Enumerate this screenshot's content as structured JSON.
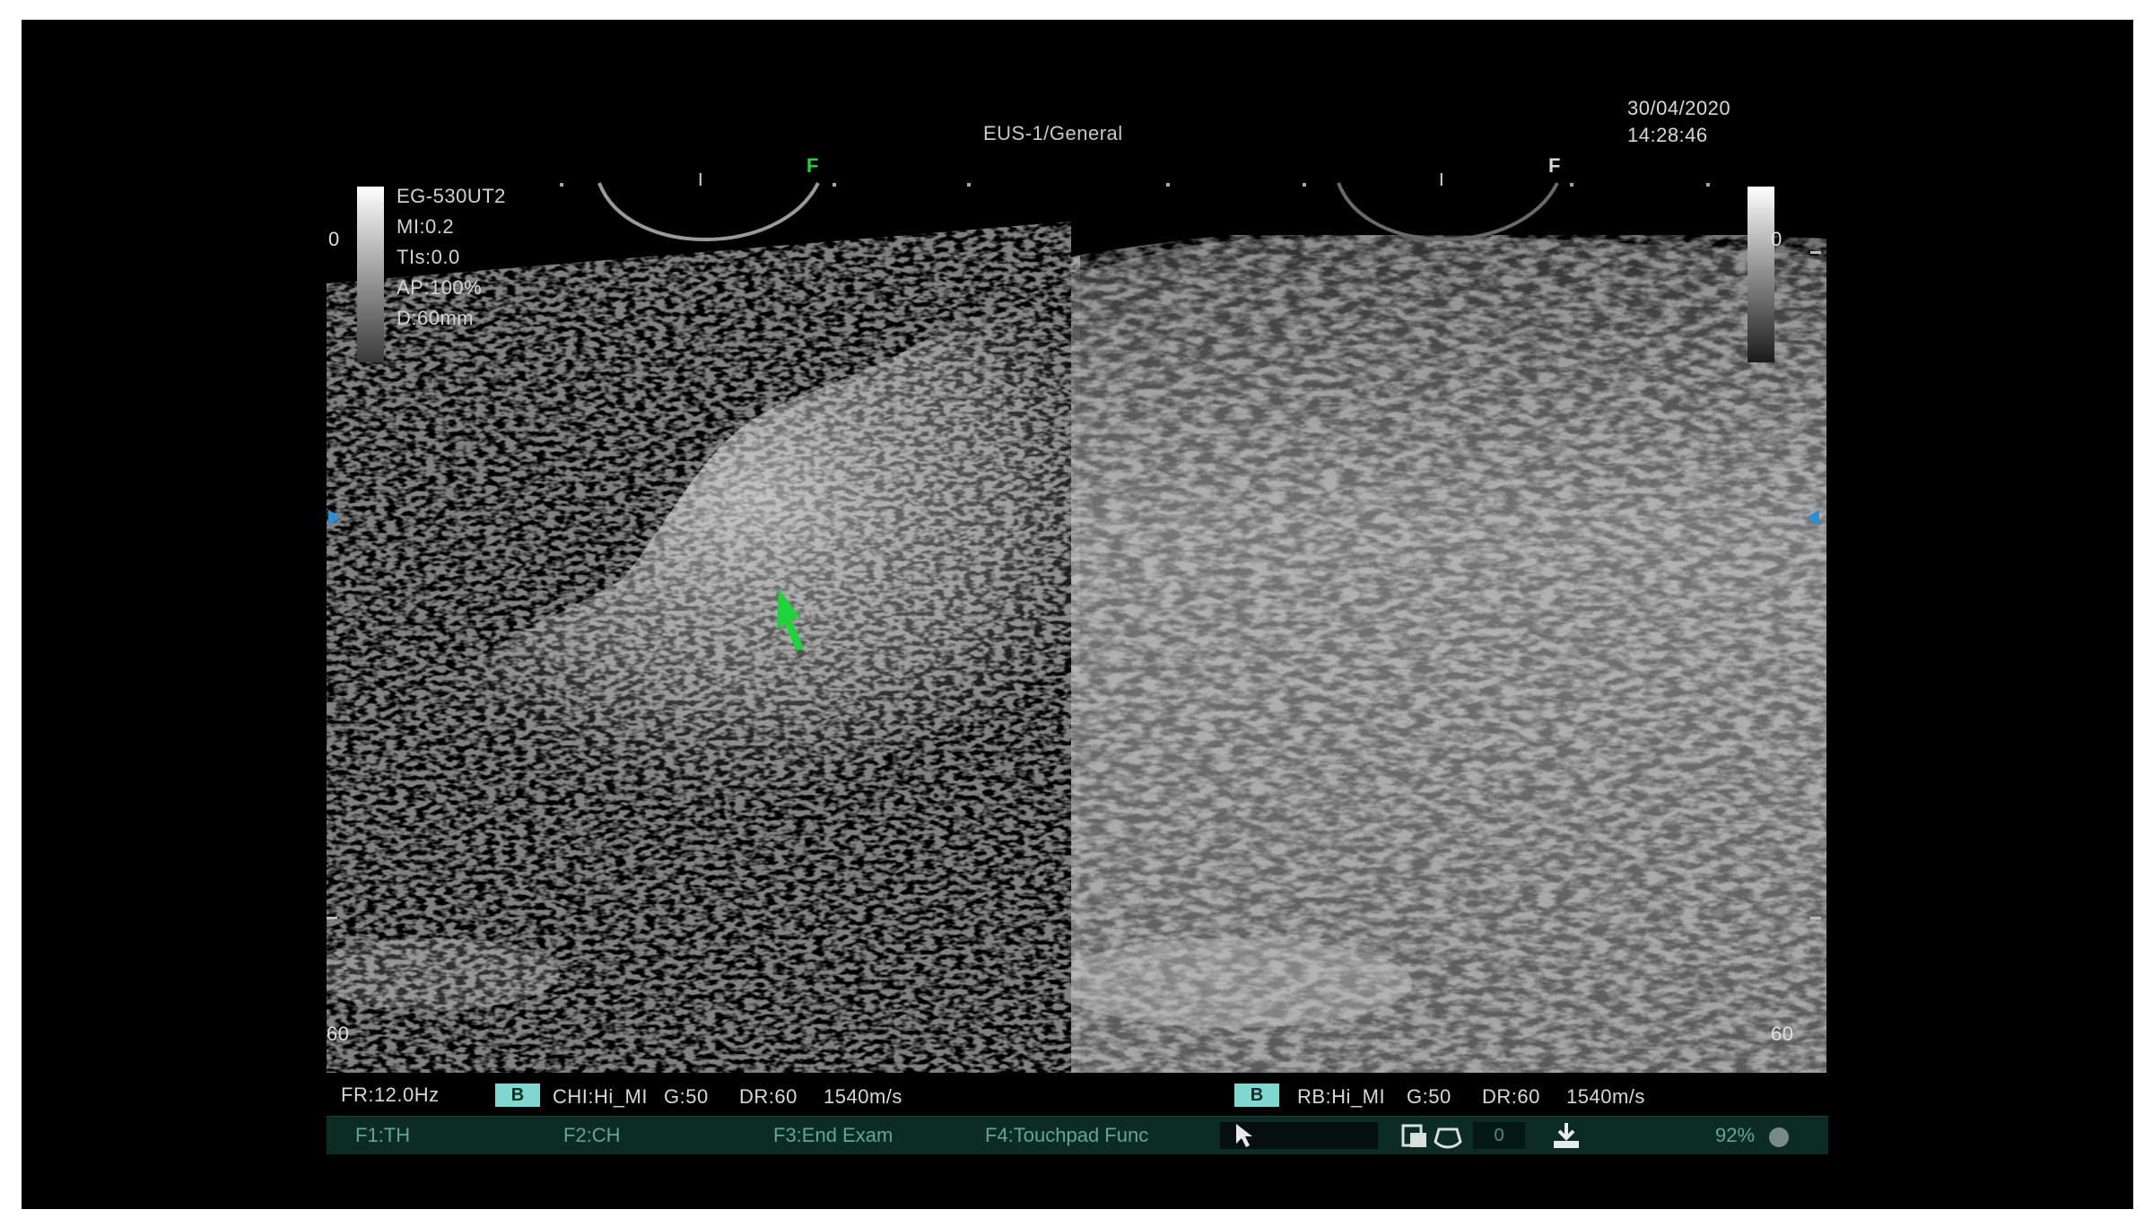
{
  "header": {
    "mode": "EUS-1/General",
    "date": "30/04/2020",
    "time": "14:28:46"
  },
  "params": {
    "probe": "EG-530UT2",
    "mi": "MI:0.2",
    "tis": "TIs:0.0",
    "ap": "AP:100%",
    "depth": "D:60mm"
  },
  "depth_labels": {
    "left_top": "0",
    "left_bottom": "60",
    "right_top": "0",
    "right_bottom": "60"
  },
  "focus_marks": {
    "left": "F",
    "right": "F"
  },
  "status": {
    "frame_rate": "FR:12.0Hz",
    "left": {
      "badge": "B",
      "mode": "CHI:Hi_MI",
      "gain": "G:50",
      "dr": "DR:60",
      "speed": "1540m/s"
    },
    "right": {
      "badge": "B",
      "mode": "RB:Hi_MI",
      "gain": "G:50",
      "dr": "DR:60",
      "speed": "1540m/s"
    }
  },
  "function_bar": {
    "f1": "F1:TH",
    "f2": "F2:CH",
    "f3": "F3:End Exam",
    "f4": "F4:Touchpad Func",
    "counter": "0",
    "percent": "92%"
  },
  "colors": {
    "accent_green": "#1fd33a",
    "marker_blue": "#2a8fd4",
    "function_bar_bg": "#0d2b25",
    "badge_bg": "#7fd8d0"
  },
  "icons": {
    "arrow": "green-arrow-icon",
    "cursor": "pointer-cursor-icon",
    "save": "save-image-icon",
    "probe": "probe-shape-icon",
    "download": "download-icon",
    "indicator": "status-dot-icon"
  }
}
